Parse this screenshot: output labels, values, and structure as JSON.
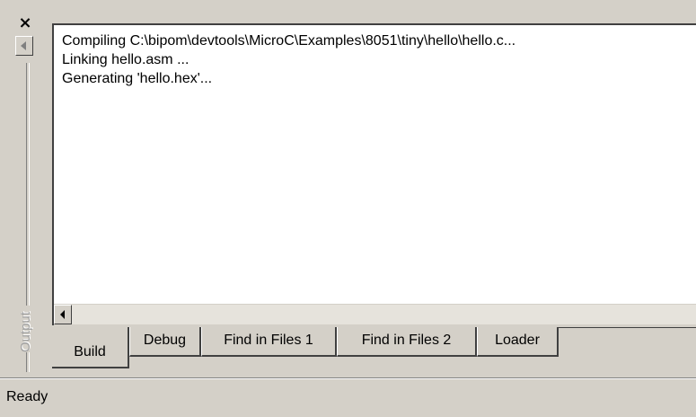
{
  "dock": {
    "close_glyph": "×",
    "title": "Output"
  },
  "output": {
    "lines": [
      "Compiling C:\\bipom\\devtools\\MicroC\\Examples\\8051\\tiny\\hello\\hello.c...",
      "Linking hello.asm ...",
      "Generating 'hello.hex'..."
    ]
  },
  "tabs": [
    {
      "label": "Build",
      "active": true
    },
    {
      "label": "Debug",
      "active": false
    },
    {
      "label": "Find in Files 1",
      "active": false
    },
    {
      "label": "Find in Files 2",
      "active": false
    },
    {
      "label": "Loader",
      "active": false
    }
  ],
  "statusbar": {
    "text": "Ready"
  }
}
